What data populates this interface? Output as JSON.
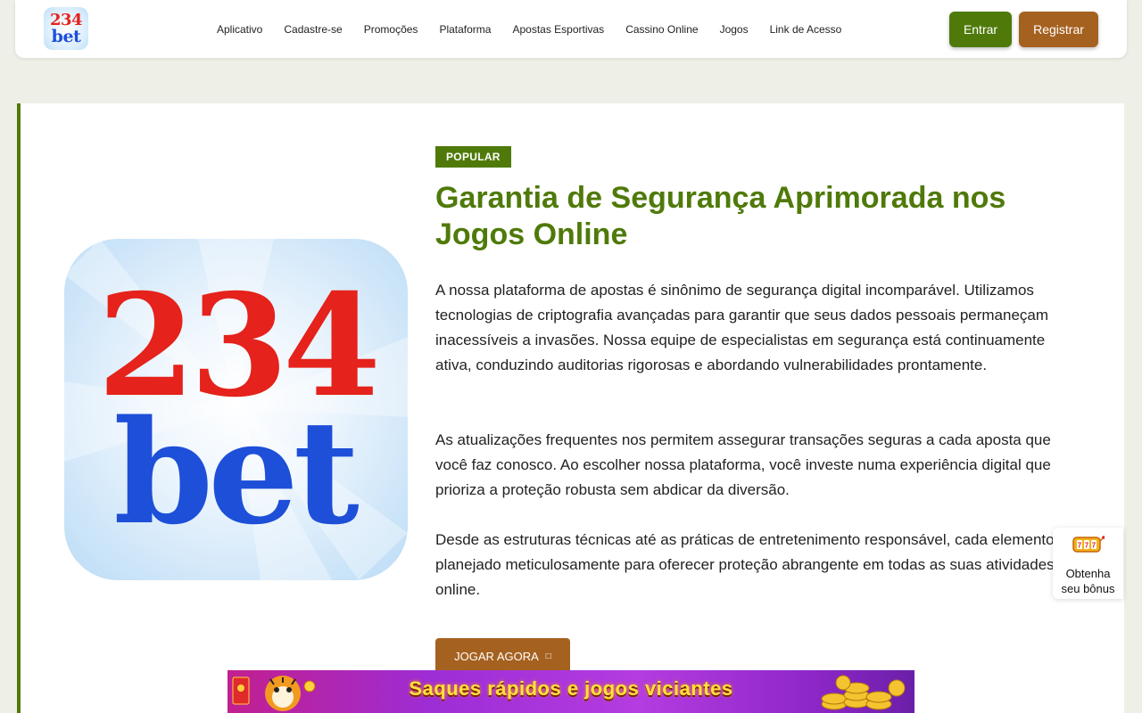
{
  "header": {
    "logo": {
      "line1": "234",
      "line2": "bet"
    },
    "nav": [
      "Aplicativo",
      "Cadastre-se",
      "Promoções",
      "Plataforma",
      "Apostas Esportivas",
      "Cassino Online",
      "Jogos",
      "Link de Acesso"
    ],
    "login_label": "Entrar",
    "register_label": "Registrar"
  },
  "hero": {
    "image_logo": {
      "line1": "234",
      "line2": "bet"
    },
    "badge": "POPULAR",
    "title": "Garantia de Segurança Aprimorada nos Jogos Online",
    "paragraphs": [
      "A nossa plataforma de apostas é sinônimo de segurança digital incomparável. Utilizamos tecnologias de criptografia avançadas para garantir que seus dados pessoais permaneçam inacessíveis a invasões. Nossa equipe de especialistas em segurança está continuamente ativa, conduzindo auditorias rigorosas e abordando vulnerabilidades prontamente.",
      "As atualizações frequentes nos permitem assegurar transações seguras a cada aposta que você faz conosco. Ao escolher nossa plataforma, você investe numa experiência digital que prioriza a proteção robusta sem abdicar da diversão.",
      "Desde as estruturas técnicas até as práticas de entretenimento responsável, cada elemento é planejado meticulosamente para oferecer proteção abrangente em todas as suas atividades online."
    ],
    "cta_label": "JOGAR AGORA",
    "cta_icon": "arrow-icon"
  },
  "bonus": {
    "icon": "slot-machine-icon",
    "label_line1": "Obtenha",
    "label_line2": "seu bônus"
  },
  "banner": {
    "text": "Saques rápidos e jogos viciantes"
  },
  "colors": {
    "brand_green": "#4f7a0a",
    "brand_brown": "#a5611f",
    "logo_red": "#e5221b",
    "logo_blue": "#1d4fd8",
    "page_bg": "#eef0e8",
    "banner_text": "#ffe23a"
  }
}
